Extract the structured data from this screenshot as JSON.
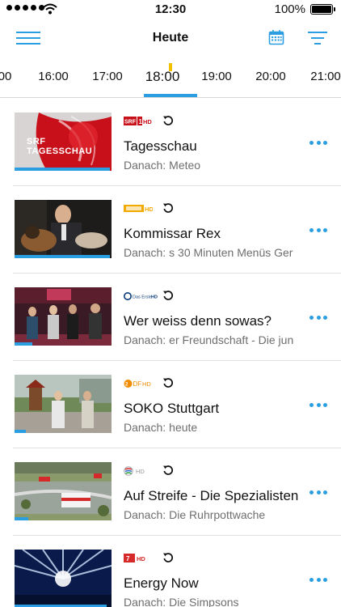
{
  "status_bar": {
    "time": "12:30",
    "battery": "100%",
    "signal_dots": 5
  },
  "nav": {
    "title": "Heute",
    "icons": [
      "menu-icon",
      "calendar-icon",
      "filter-icon"
    ]
  },
  "colors": {
    "accent": "#2a9ee0",
    "marker": "#f2c200",
    "separator": "#e0e0e0",
    "secondary_text": "#6e6e6e"
  },
  "timeline": {
    "ticks": [
      "00",
      "16:00",
      "17:00",
      "18:00",
      "19:00",
      "20:00",
      "21:00"
    ],
    "active": "18:00"
  },
  "next_label": "Danach:",
  "programs": [
    {
      "channel": "SRF 1 HD",
      "title": "Tagesschau",
      "next": "Meteo",
      "thumb_caption": "SRF TAGESSCHAU",
      "progress": 0.98
    },
    {
      "channel": "ZDFneo HD",
      "title": "Kommissar Rex",
      "next": "s 30 Minuten Menüs Ger",
      "progress": 0.98
    },
    {
      "channel": "Das Erste HD",
      "title": "Wer weiss denn sowas?",
      "next": "er Freundschaft - Die jun",
      "progress": 0.18
    },
    {
      "channel": "ZDF HD",
      "title": "SOKO Stuttgart",
      "next": "heute",
      "progress": 0.12
    },
    {
      "channel": "SAT.1 HD",
      "title": "Auf Streife - Die Spezialisten",
      "next": "Die Ruhrpottwache",
      "progress": 0.14
    },
    {
      "channel": "ProSieben HD",
      "title": "Energy Now",
      "next": "Die Simpsons",
      "progress": 0.95
    }
  ]
}
